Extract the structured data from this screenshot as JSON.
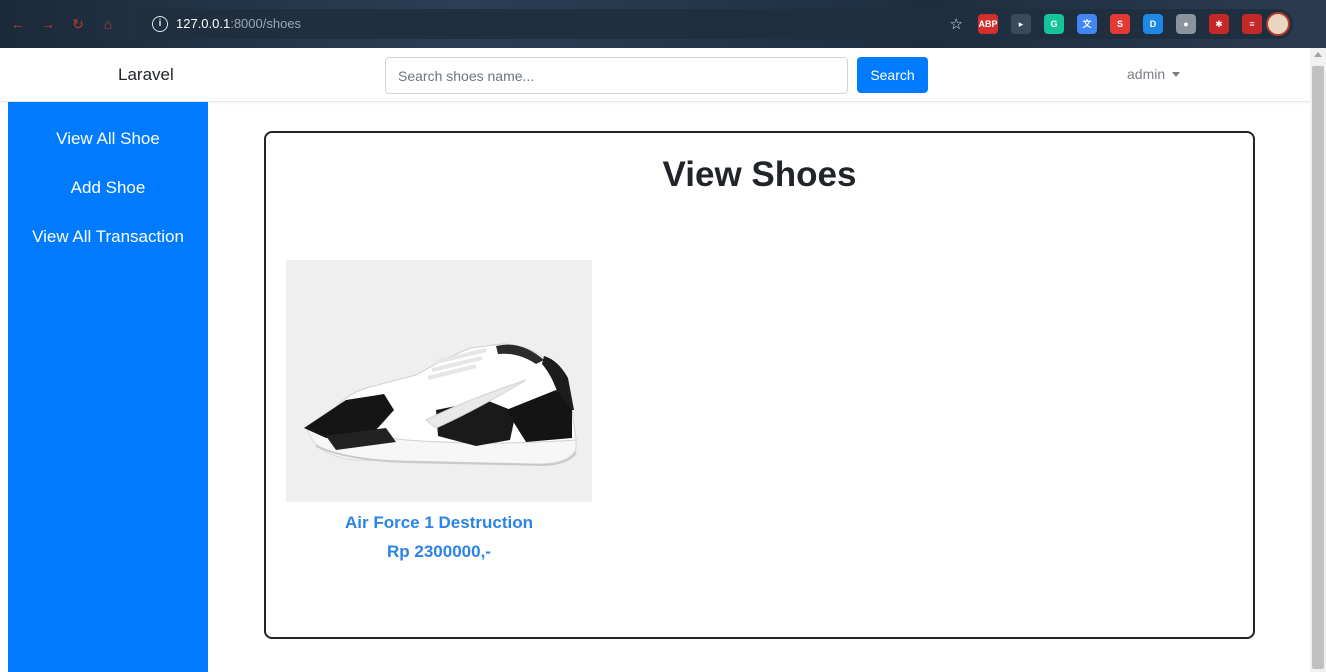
{
  "browser": {
    "url_host": "127.0.0.1",
    "url_path": ":8000/shoes",
    "extensions": [
      {
        "name": "abp-icon",
        "label": "ABP",
        "color": "#d32f2f"
      },
      {
        "name": "play-icon",
        "label": "▸",
        "color": "#3b4b5b"
      },
      {
        "name": "grammarly-icon",
        "label": "G",
        "color": "#15c39a"
      },
      {
        "name": "translate-icon",
        "label": "文",
        "color": "#4285f4"
      },
      {
        "name": "s-extension-icon",
        "label": "S",
        "color": "#e53935"
      },
      {
        "name": "d-extension-icon",
        "label": "D",
        "color": "#1e88e5"
      },
      {
        "name": "globe-icon",
        "label": "●",
        "color": "#8a949e"
      },
      {
        "name": "puzzle-icon",
        "label": "✱",
        "color": "#c62828"
      },
      {
        "name": "sidebar-extension-icon",
        "label": "≡",
        "color": "#c62828"
      }
    ]
  },
  "navbar": {
    "brand": "Laravel",
    "search_placeholder": "Search shoes name...",
    "search_button": "Search",
    "user": "admin"
  },
  "sidebar": {
    "items": [
      {
        "label": "View All Shoe"
      },
      {
        "label": "Add Shoe"
      },
      {
        "label": "View All Transaction"
      }
    ]
  },
  "main": {
    "title": "View Shoes",
    "products": [
      {
        "name": "Air Force 1 Destruction",
        "price": "Rp 2300000,-"
      }
    ]
  },
  "colors": {
    "primary": "#007bff",
    "link": "#2a84e6",
    "text": "#212529"
  }
}
